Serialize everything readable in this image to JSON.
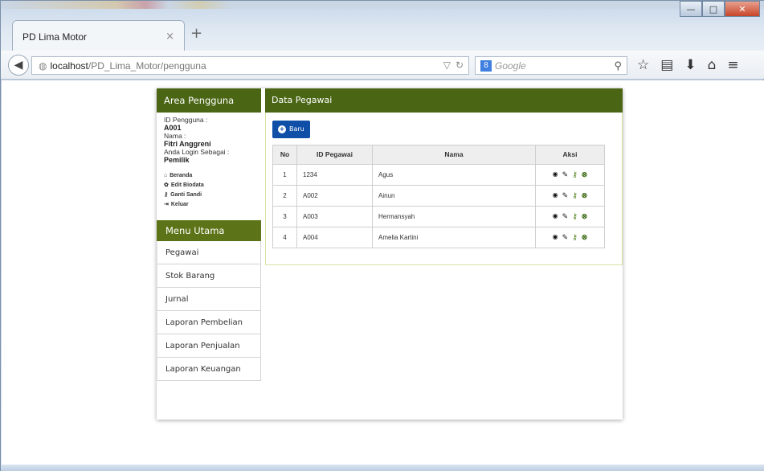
{
  "browser": {
    "tab_title": "PD Lima Motor",
    "tab_close": "×",
    "new_tab": "+",
    "url_host": "localhost",
    "url_path": "/PD_Lima_Motor/pengguna",
    "search_placeholder": "Google",
    "search_engine_badge": "8",
    "window_controls": [
      "minimize-icon",
      "maximize-icon",
      "close-icon"
    ]
  },
  "sidebar": {
    "header": "Area Pengguna",
    "user": {
      "id_label": "ID Pengguna :",
      "id_value": "A001",
      "name_label": "Nama :",
      "name_value": "Fitri Anggreni",
      "role_label": "Anda Login Sebagai :",
      "role_value": "Pemilik"
    },
    "links": [
      {
        "label": "Beranda",
        "icon": "home-icon"
      },
      {
        "label": "Edit Biodata",
        "icon": "gear-icon"
      },
      {
        "label": "Ganti Sandi",
        "icon": "key-icon"
      },
      {
        "label": "Keluar",
        "icon": "logout-icon"
      }
    ],
    "menu_header": "Menu Utama",
    "menu_items": [
      {
        "label": "Pegawai"
      },
      {
        "label": "Stok Barang"
      },
      {
        "label": "Jurnal"
      },
      {
        "label": "Laporan Pembelian"
      },
      {
        "label": "Laporan Penjualan"
      },
      {
        "label": "Laporan Keuangan"
      }
    ]
  },
  "main": {
    "header": "Data Pegawai",
    "new_button": "Baru",
    "table": {
      "columns": [
        "No",
        "ID Pegawai",
        "Nama",
        "Aksi"
      ],
      "rows": [
        {
          "no": "1",
          "id": "1234",
          "nama": "Agus"
        },
        {
          "no": "2",
          "id": "A002",
          "nama": "Ainun"
        },
        {
          "no": "3",
          "id": "A003",
          "nama": "Hermansyah"
        },
        {
          "no": "4",
          "id": "A004",
          "nama": "Amelia Kartini"
        }
      ],
      "action_icons": [
        "view-icon",
        "edit-icon",
        "password-icon",
        "delete-icon"
      ]
    }
  },
  "colors": {
    "header_green": "#4a6514",
    "menu_green": "#5d7317",
    "button_blue": "#0f4fa8"
  }
}
